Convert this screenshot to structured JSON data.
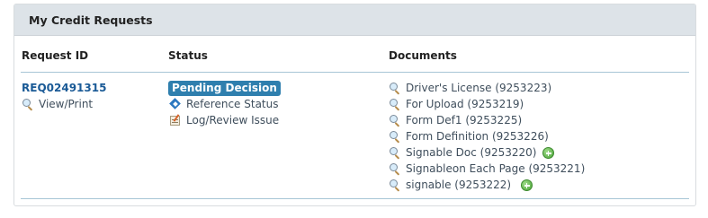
{
  "panel": {
    "title": "My Credit Requests"
  },
  "columns": {
    "request_id": "Request ID",
    "status": "Status",
    "documents": "Documents"
  },
  "request": {
    "id": "REQ02491315",
    "view_print": "View/Print",
    "status": "Pending Decision",
    "status_color": "#2f7fae",
    "actions": [
      "Reference Status",
      "Log/Review Issue"
    ],
    "documents": [
      {
        "label": "Driver's License (9253223)",
        "add": false
      },
      {
        "label": "For Upload (9253219)",
        "add": false
      },
      {
        "label": "Form Def1 (9253225)",
        "add": false
      },
      {
        "label": "Form Definition (9253226)",
        "add": false
      },
      {
        "label": "Signable Doc (9253220)",
        "add": true
      },
      {
        "label": "Signableon Each Page (9253221)",
        "add": false
      },
      {
        "label": "signable (9253222)",
        "add": true
      }
    ]
  },
  "icons": {
    "view": "magnifier-icon",
    "reference": "reference-status-icon",
    "log": "log-review-icon",
    "add": "add-plus-icon"
  }
}
